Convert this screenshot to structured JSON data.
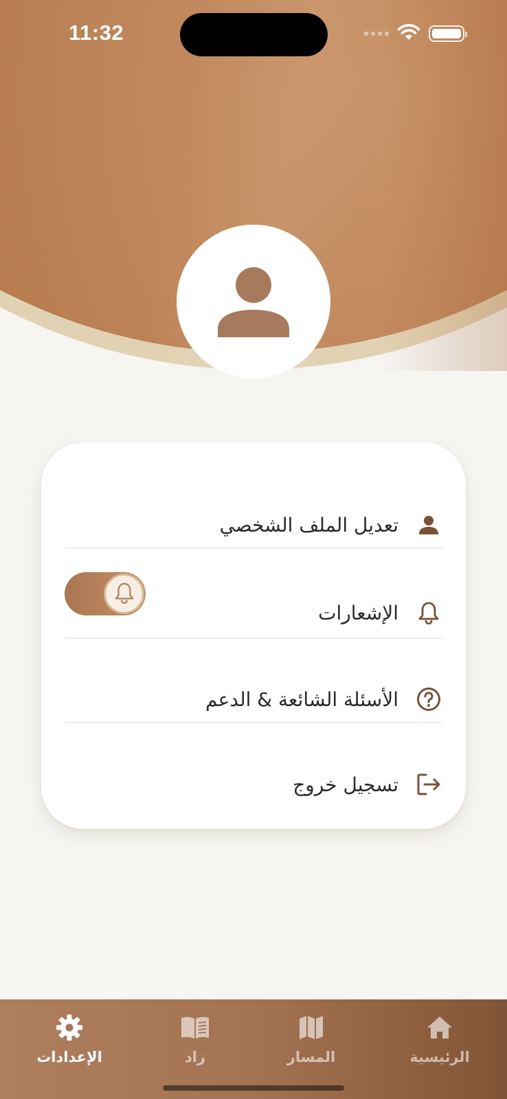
{
  "status_bar": {
    "time": "11:32",
    "wifi_icon": "wifi-icon",
    "battery_icon": "battery-icon"
  },
  "profile": {
    "avatar_icon": "person-icon"
  },
  "settings": {
    "items": [
      {
        "label": "تعديل الملف الشخصي",
        "icon": "person-icon"
      },
      {
        "label": "الإشعارات",
        "icon": "bell-icon",
        "toggle_on": true
      },
      {
        "label": "الأسئلة الشائعة & الدعم",
        "icon": "question-circle-icon"
      },
      {
        "label": "تسجيل خروج",
        "icon": "logout-icon"
      }
    ]
  },
  "bottom_nav": {
    "items": [
      {
        "label": "الرئيسية",
        "icon": "home-icon"
      },
      {
        "label": "المسار",
        "icon": "map-icon"
      },
      {
        "label": "زاد",
        "icon": "book-icon"
      },
      {
        "label": "الإعدادات",
        "icon": "gear-icon",
        "active": true
      }
    ]
  },
  "colors": {
    "accent": "#A87651",
    "header": "#BD8457",
    "rim": "#E2D2B4",
    "background": "#F6F5F2",
    "icon": "#7A5138"
  }
}
